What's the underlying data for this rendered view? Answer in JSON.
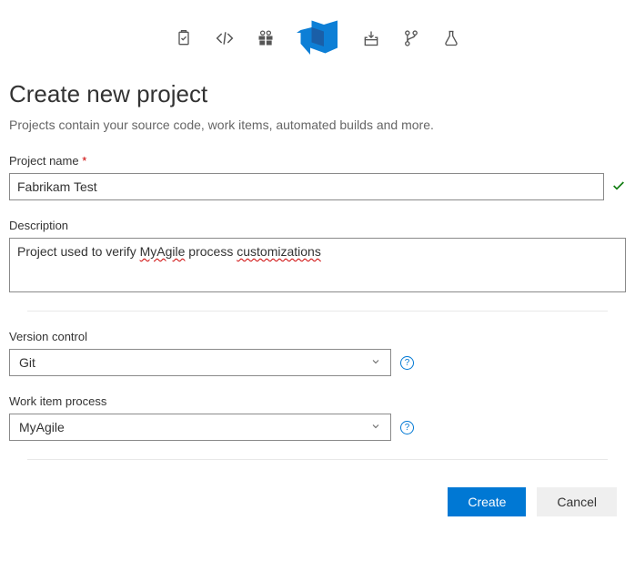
{
  "header": {
    "title": "Create new project",
    "subtitle": "Projects contain your source code, work items, automated builds and more."
  },
  "fields": {
    "project_name": {
      "label": "Project name",
      "required_marker": "*",
      "value": "Fabrikam Test"
    },
    "description": {
      "label": "Description",
      "value_pre": "Project used to verify ",
      "value_word1": "MyAgile",
      "value_mid": " process ",
      "value_word2": "customizations"
    },
    "version_control": {
      "label": "Version control",
      "value": "Git"
    },
    "work_item_process": {
      "label": "Work item process",
      "value": "MyAgile"
    }
  },
  "buttons": {
    "create": "Create",
    "cancel": "Cancel"
  },
  "help": "?"
}
